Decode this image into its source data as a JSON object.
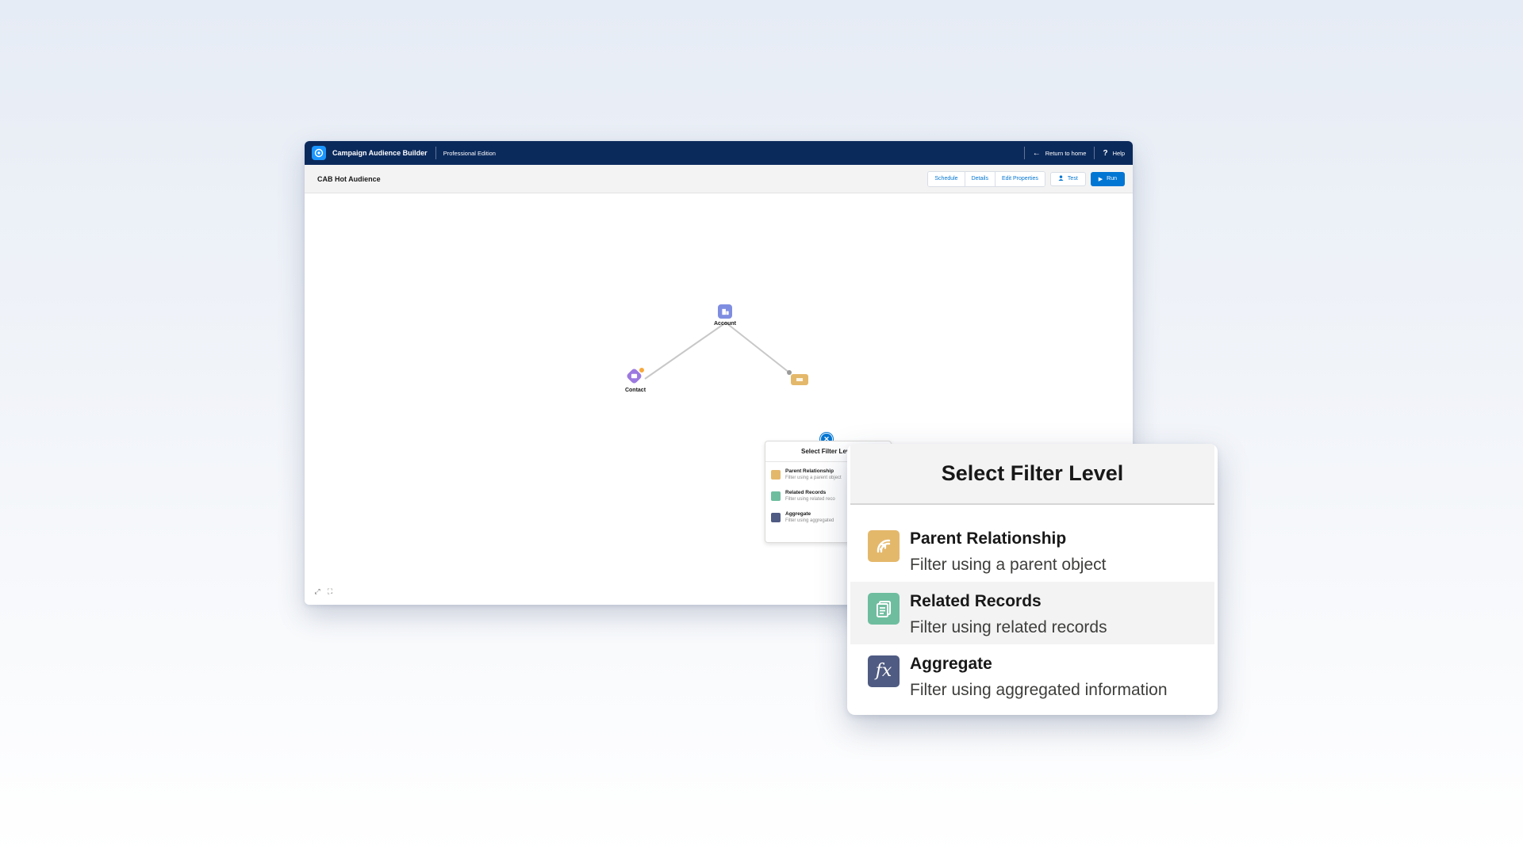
{
  "app": {
    "title": "Campaign Audience Builder",
    "edition": "Professional Edition",
    "return_home_label": "Return to home",
    "help_label": "Help"
  },
  "toolbar": {
    "page_title": "CAB Hot Audience",
    "schedule_label": "Schedule",
    "details_label": "Details",
    "edit_properties_label": "Edit Properties",
    "test_label": "Test",
    "run_label": "Run"
  },
  "canvas": {
    "nodes": {
      "account": {
        "label": "Account",
        "color": "#7f8de1"
      },
      "contact": {
        "label": "Contact",
        "color": "#9c79e0"
      },
      "filter": {
        "color": "#e4b86b"
      }
    },
    "controls": [
      "expand-icon",
      "fit-screen-icon"
    ]
  },
  "filter_popover": {
    "title": "Select Filter Level",
    "options": [
      {
        "label": "Parent Relationship",
        "description": "Filter using a parent object",
        "icon": "parent-relationship-icon",
        "color": "#e4b86b"
      },
      {
        "label": "Related Records",
        "description": "Filter using related records",
        "icon": "related-records-icon",
        "color": "#6ebd9f"
      },
      {
        "label": "Aggregate",
        "description": "Filter using aggregated information",
        "icon": "aggregate-icon",
        "color": "#4f5b82"
      }
    ],
    "mini_options": [
      {
        "label": "Parent Relationship",
        "description": "Filter using a parent object"
      },
      {
        "label": "Related Records",
        "description": "Filter using related reco"
      },
      {
        "label": "Aggregate",
        "description": "Filter using aggregated"
      }
    ]
  },
  "colors": {
    "header_bg": "#0b2a5c",
    "brand_blue": "#0176d3"
  }
}
